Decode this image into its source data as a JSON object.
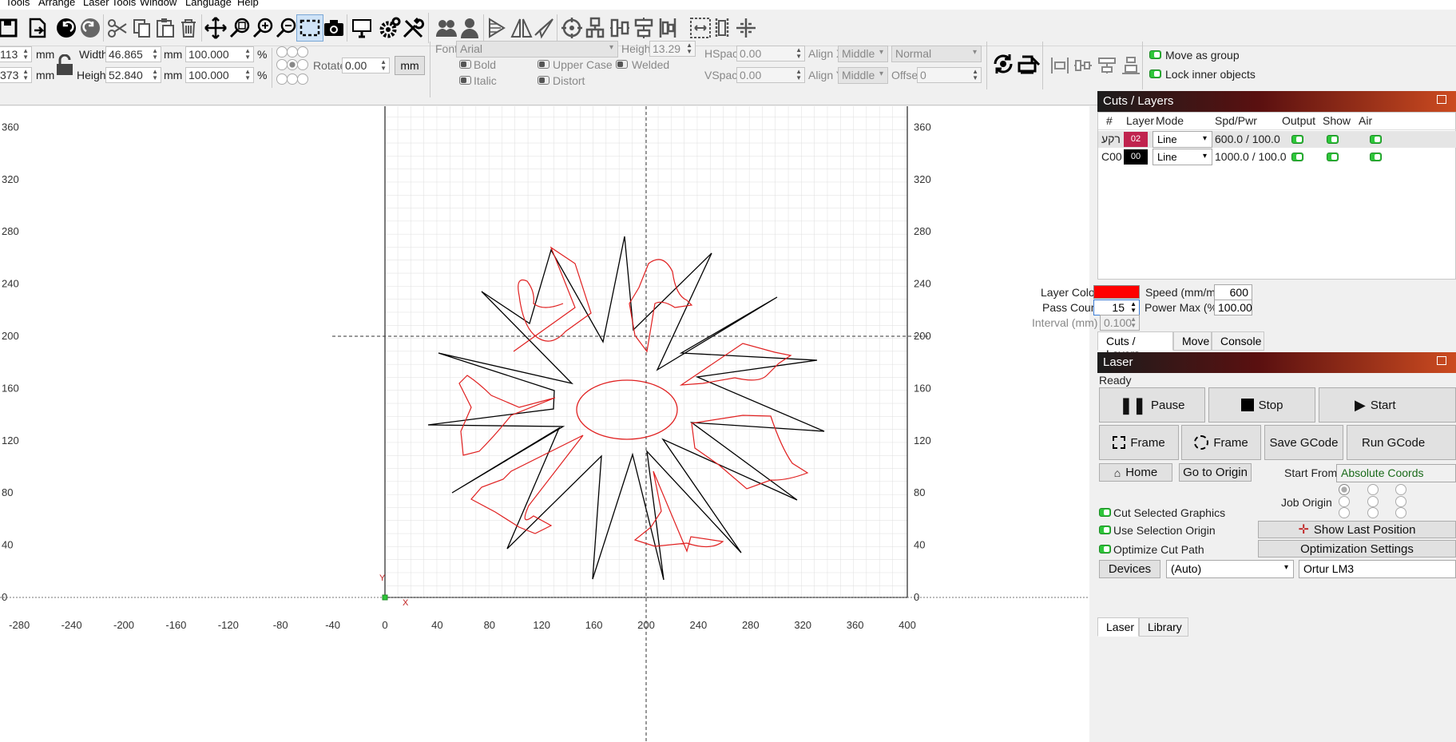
{
  "menu": [
    "Tools",
    "Arrange",
    "Laser Tools",
    "Window",
    "Language",
    "Help"
  ],
  "toolbar_icons": [
    "open-icon",
    "save-icon",
    "undo-icon",
    "redo-icon",
    "cut-icon",
    "copy-icon",
    "paste-icon",
    "delete-icon",
    "move-icon",
    "zoom-fit-icon",
    "zoom-in-icon",
    "zoom-out-icon",
    "frame-select-icon",
    "camera-icon",
    "monitor-icon",
    "settings-icon",
    "tools-icon",
    "group-icon",
    "ungroup-icon",
    "mirror-h-icon",
    "mirror-v-icon",
    "rotate-icon",
    "target-icon",
    "align-icon",
    "distribute-icon",
    "align-center-icon",
    "array-icon",
    "offset-icon",
    "grid-icon"
  ],
  "props": {
    "x_value": "113",
    "y_value": "373",
    "x_unit": "mm",
    "y_unit": "mm",
    "width_label": "Width",
    "width_value": "46.865",
    "width_unit": "mm",
    "width_pct": "100.000",
    "pct": "%",
    "height_label": "Height",
    "height_value": "52.840",
    "height_unit": "mm",
    "height_pct": "100.000",
    "rotate_label": "Rotate",
    "rotate_value": "0.00",
    "units_button": "mm",
    "font_label": "Font",
    "font_value": "Arial",
    "text_height_label": "Height",
    "text_height_value": "13.29",
    "hspace_label": "HSpace",
    "hspace_value": "0.00",
    "vspace_label": "VSpace",
    "vspace_value": "0.00",
    "alignx_label": "Align X",
    "alignx_value": "Middle",
    "aligny_label": "Align Y",
    "aligny_value": "Middle",
    "normal_value": "Normal",
    "offset_label": "Offset",
    "offset_value": "0",
    "bold": "Bold",
    "italic": "Italic",
    "uppercase": "Upper Case",
    "distort": "Distort",
    "welded": "Welded",
    "move_as_group": "Move as group",
    "lock_inner": "Lock inner objects"
  },
  "canvas": {
    "ruler_x": [
      "-280",
      "-240",
      "-200",
      "-160",
      "-120",
      "-80",
      "-40",
      "0",
      "40",
      "80",
      "120",
      "160",
      "200",
      "240",
      "280",
      "320",
      "360",
      "400"
    ],
    "ruler_y": [
      "360",
      "320",
      "280",
      "240",
      "200",
      "160",
      "120",
      "80",
      "40",
      "0"
    ],
    "origin_y": "Y",
    "origin_x": "X"
  },
  "cuts": {
    "title": "Cuts / Layers",
    "headers": [
      "#",
      "Layer",
      "Mode",
      "Spd/Pwr",
      "Output",
      "Show",
      "Air"
    ],
    "rows": [
      {
        "name": "רקע",
        "layer": "02",
        "color": "#c0234e",
        "mode": "Line",
        "spdpwr": "600.0 / 100.0"
      },
      {
        "name": "C00",
        "layer": "00",
        "color": "#000000",
        "mode": "Line",
        "spdpwr": "1000.0 / 100.0"
      }
    ],
    "layer_color_label": "Layer Color",
    "layer_color": "#ff0000",
    "speed_label": "Speed (mm/m)",
    "speed_value": "600",
    "pass_count_label": "Pass Count",
    "pass_count_value": "15",
    "power_max_label": "Power Max (%)",
    "power_max_value": "100.00",
    "interval_label": "Interval (mm)",
    "interval_value": "0.100",
    "tabs": [
      "Cuts / Layers",
      "Move",
      "Console"
    ]
  },
  "laser": {
    "title": "Laser",
    "status": "Ready",
    "pause": "Pause",
    "stop": "Stop",
    "start": "Start",
    "frame1": "Frame",
    "frame2": "Frame",
    "save_gcode": "Save GCode",
    "run_gcode": "Run GCode",
    "home": "Home",
    "go_origin": "Go to Origin",
    "start_from_label": "Start From:",
    "start_from_value": "Absolute Coords",
    "job_origin_label": "Job Origin",
    "cut_selected": "Cut Selected Graphics",
    "use_selection_origin": "Use Selection Origin",
    "optimize_cut": "Optimize Cut Path",
    "show_last_position": "Show Last Position",
    "optimization_settings": "Optimization Settings",
    "devices": "Devices",
    "port_value": "(Auto)",
    "device_value": "Ortur LM3",
    "tabs": [
      "Laser",
      "Library"
    ]
  }
}
